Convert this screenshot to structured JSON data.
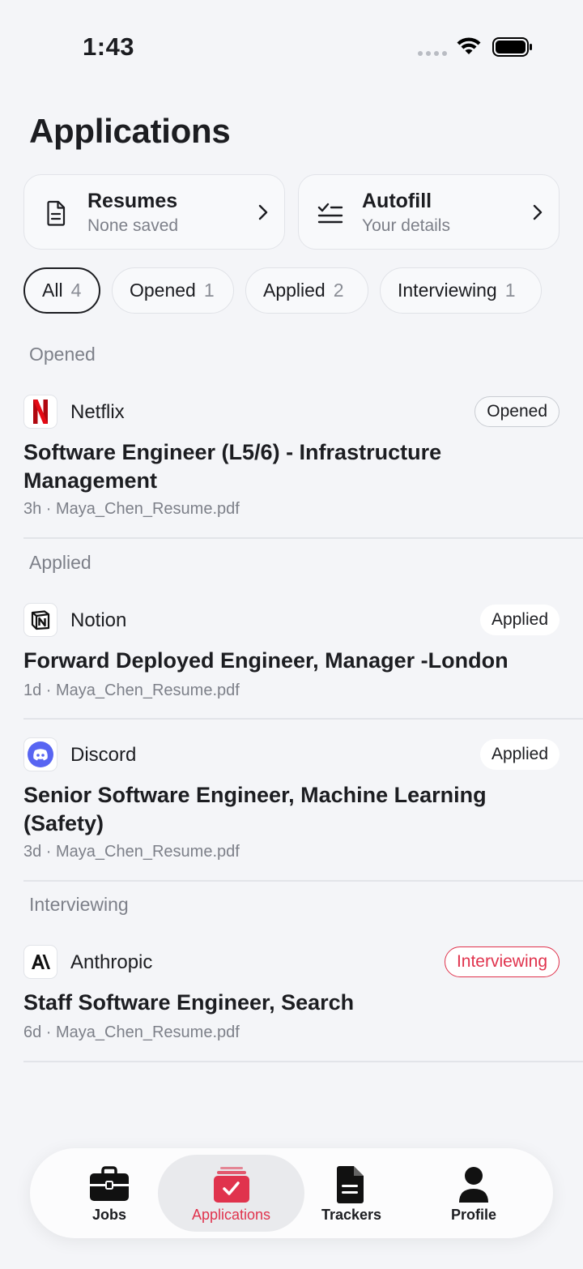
{
  "status": {
    "time": "1:43"
  },
  "page": {
    "title": "Applications"
  },
  "cards": {
    "resumes": {
      "title": "Resumes",
      "subtitle": "None saved"
    },
    "autofill": {
      "title": "Autofill",
      "subtitle": "Your details"
    }
  },
  "filters": [
    {
      "label": "All",
      "count": "4",
      "active": true
    },
    {
      "label": "Opened",
      "count": "1"
    },
    {
      "label": "Applied",
      "count": "2"
    },
    {
      "label": "Interviewing",
      "count": "1"
    }
  ],
  "sections": {
    "opened": "Opened",
    "applied": "Applied",
    "interviewing": "Interviewing"
  },
  "applications": [
    {
      "company": "Netflix",
      "title": "Software Engineer (L5/6) - Infrastructure Management",
      "meta": "3h · Maya_Chen_Resume.pdf",
      "status": "Opened",
      "logo": "netflix-logo"
    },
    {
      "company": "Notion",
      "title": "Forward Deployed Engineer, Manager -London",
      "meta": "1d · Maya_Chen_Resume.pdf",
      "status": "Applied",
      "logo": "notion-logo"
    },
    {
      "company": "Discord",
      "title": "Senior Software Engineer, Machine Learning (Safety)",
      "meta": "3d · Maya_Chen_Resume.pdf",
      "status": "Applied",
      "logo": "discord-logo"
    },
    {
      "company": "Anthropic",
      "title": "Staff Software Engineer, Search",
      "meta": "6d · Maya_Chen_Resume.pdf",
      "status": "Interviewing",
      "logo": "anthropic-logo"
    }
  ],
  "tabs": [
    {
      "label": "Jobs",
      "icon": "briefcase-icon"
    },
    {
      "label": "Applications",
      "icon": "applications-icon",
      "active": true
    },
    {
      "label": "Trackers",
      "icon": "document-icon"
    },
    {
      "label": "Profile",
      "icon": "person-icon"
    }
  ],
  "colors": {
    "accent": "#e0334d",
    "background": "#f4f5f8",
    "text": "#1c1d21",
    "muted": "#7d8089"
  }
}
